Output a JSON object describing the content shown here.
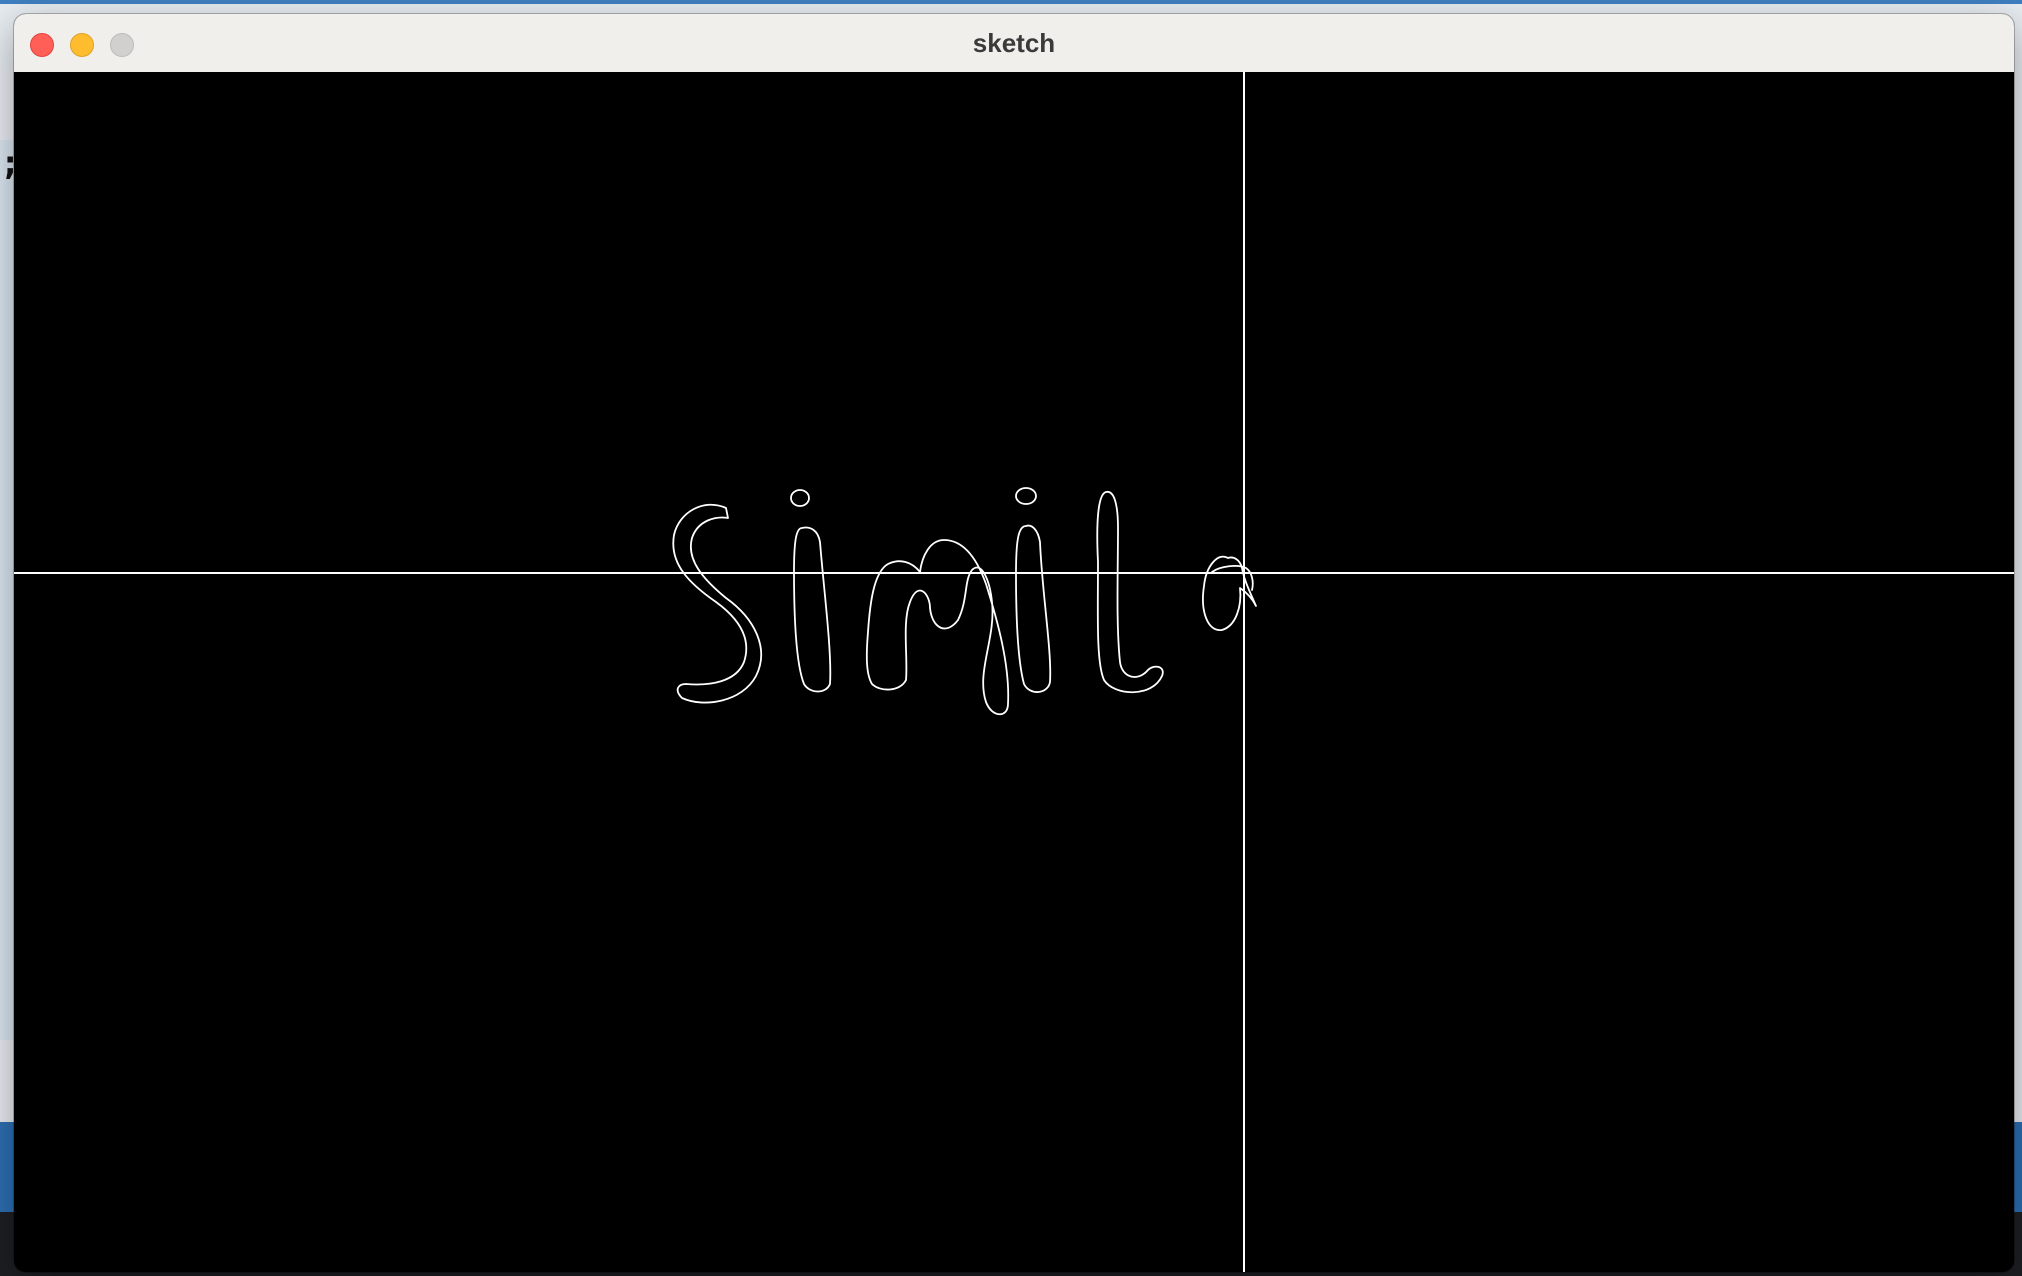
{
  "window": {
    "title": "sketch",
    "controls": {
      "close": "close",
      "minimize": "minimize",
      "zoom": "zoom"
    }
  },
  "background": {
    "left_glyph": ";"
  },
  "canvas": {
    "background_color": "#000000",
    "stroke_color": "#ffffff",
    "handwritten_text": "Simil"
  },
  "colors": {
    "close": "#ff5f57",
    "minimize": "#febc2e",
    "zoom": "#d1d0ce",
    "titlebar": "#f1efec"
  }
}
